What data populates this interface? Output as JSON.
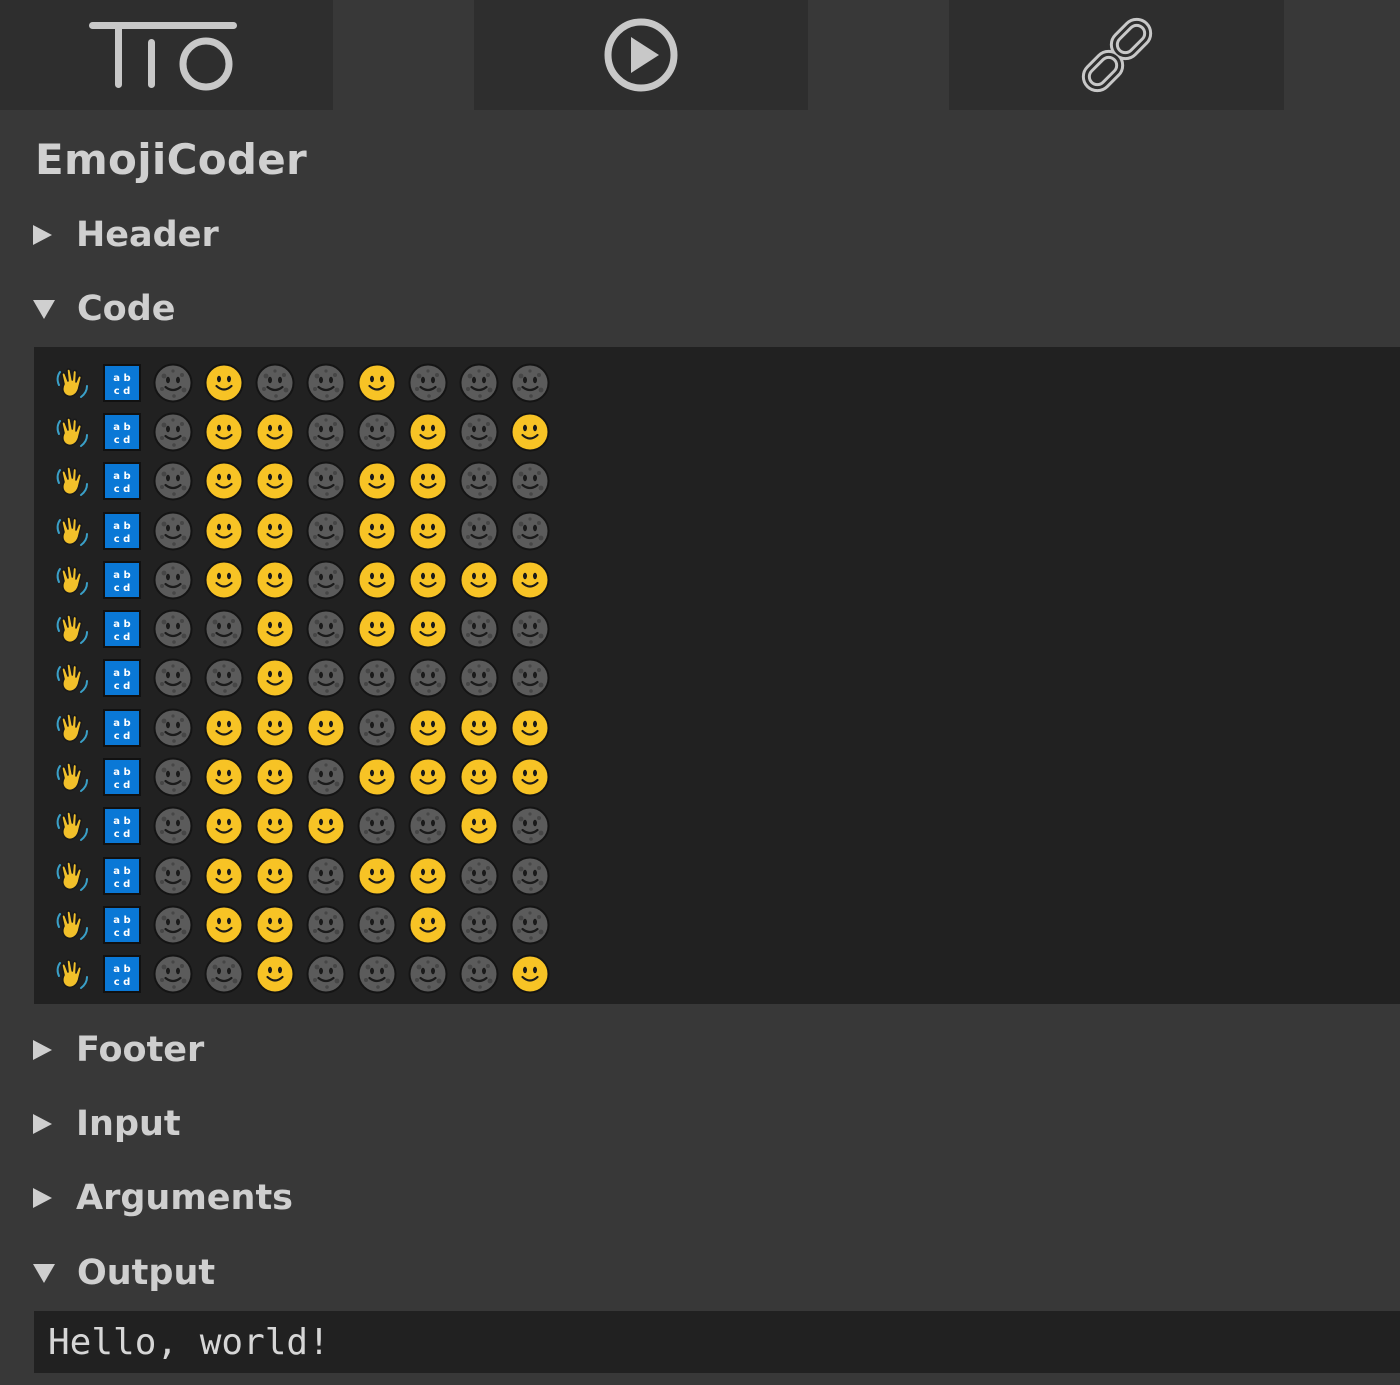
{
  "toolbar": {
    "logo_icon": "tio-logo",
    "run_icon": "play-icon",
    "permalink_icon": "link-icon"
  },
  "language": {
    "name": "EmojiCoder"
  },
  "sections": [
    {
      "label": "Header",
      "expanded": false
    },
    {
      "label": "Code",
      "expanded": true
    },
    {
      "label": "Footer",
      "expanded": false
    },
    {
      "label": "Input",
      "expanded": false
    },
    {
      "label": "Arguments",
      "expanded": false
    },
    {
      "label": "Output",
      "expanded": true
    }
  ],
  "code": {
    "legend": {
      "W": "waving-hand",
      "B": "abcd-input-symbol",
      "D": "dark-moon-face",
      "Y": "yellow-smiley-face"
    },
    "rows": [
      "WBDYDDYDDD",
      "WBDYYDDYDY",
      "WBDYYDYYDD",
      "WBDYYDYYDD",
      "WBDYYDYYYY",
      "WBDDYDYYDD",
      "WBDDYDDDDD",
      "WBDYYYDYYY",
      "WBDYYDYYYY",
      "WBDYYYDDYD",
      "WBDYYDYYDD",
      "WBDYYDDYDD",
      "WBDDYDDDDY"
    ]
  },
  "output": {
    "text": "Hello, world!"
  },
  "colors": {
    "background": "#383838",
    "toolbar": "#2e2e2e",
    "editor": "#212121",
    "text": "#d0d0d0",
    "smiley": "#f7c325",
    "moon": "#5b5b5b",
    "abcd": "#0a78d6"
  }
}
